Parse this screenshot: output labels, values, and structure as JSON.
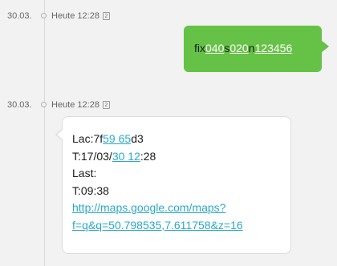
{
  "conversation": {
    "messages": [
      {
        "date": "30.03.",
        "time": "Heute 12:28",
        "sim": "2",
        "direction": "outgoing",
        "text_parts": [
          "fix",
          "040",
          "s",
          "020",
          "n",
          "123456"
        ]
      },
      {
        "date": "30.03.",
        "time": "Heute 12:28",
        "sim": "2",
        "direction": "incoming",
        "lines": {
          "lac_prefix": "Lac:7f",
          "lac_link": "59 65",
          "lac_suffix": "d3",
          "t_prefix": "T:17/03/",
          "t_link": "30 12",
          "t_suffix": ":28",
          "last": "Last:",
          "t2": "T:09:38",
          "url_line1": "http://maps.google.com/maps?",
          "url_line2": "f=q&q=50.798535,7.611758&z=16"
        }
      }
    ]
  },
  "colors": {
    "outgoing_bubble": "#66c246",
    "incoming_bubble": "#ffffff",
    "link": "#2aa9c8",
    "background": "#f2f2f2"
  }
}
